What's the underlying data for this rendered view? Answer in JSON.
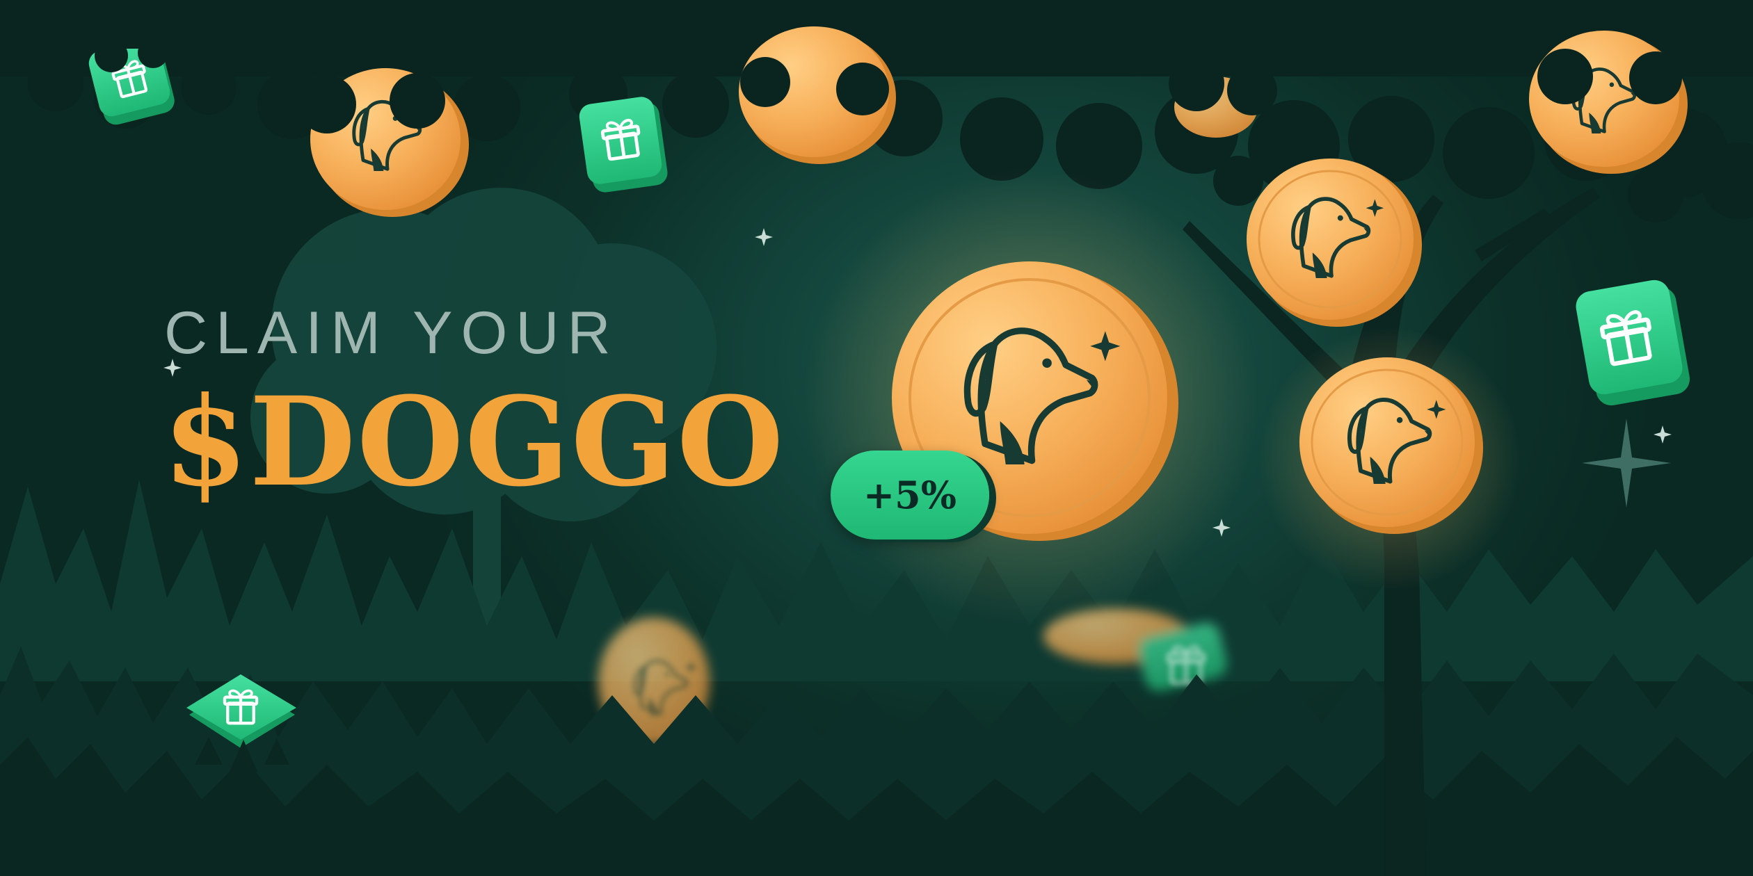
{
  "banner": {
    "headline": "CLAIM YOUR",
    "token": "$DOGGO",
    "bonus_badge": "+5%"
  },
  "colors": {
    "background": "#0f3a32",
    "headline": "#9fb6b0",
    "token": "#f2a33a",
    "coin": "#f6ad55",
    "gift": "#2ecc84",
    "badge": "#2bd38a"
  },
  "icons": [
    "dog-coin-icon",
    "gift-box-icon",
    "sparkle-icon",
    "tree-silhouette",
    "forest-silhouette"
  ]
}
